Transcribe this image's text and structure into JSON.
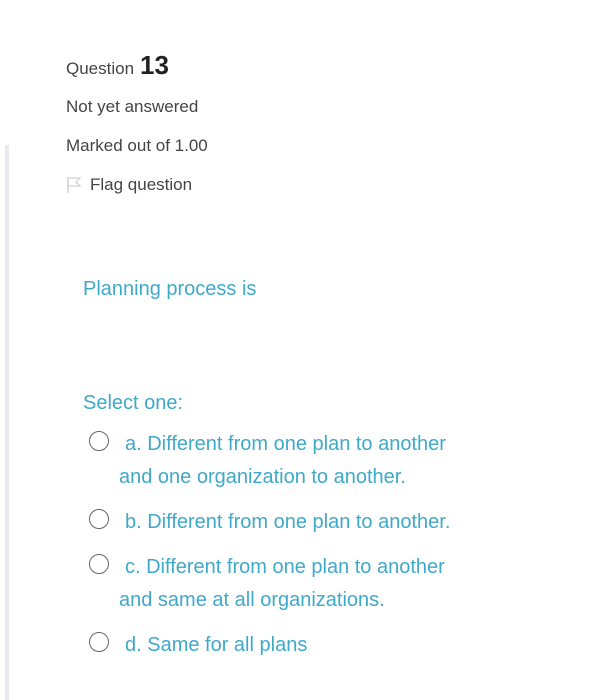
{
  "question": {
    "label": "Question",
    "number": "13",
    "state": "Not yet answered",
    "grade": "Marked out of 1.00",
    "flag_label": "Flag question",
    "flag_icon": "flag-icon"
  },
  "content": {
    "question_text": "Planning process is",
    "prompt": "Select one:",
    "options": [
      {
        "line1": "a. Different from one plan to another",
        "line2": "and one organization to another."
      },
      {
        "line1": "b. Different from one plan to another.",
        "line2": ""
      },
      {
        "line1": "c. Different from one plan to another",
        "line2": "and same at all organizations."
      },
      {
        "line1": "d. Same for all plans",
        "line2": ""
      }
    ]
  },
  "colors": {
    "accent": "#3fa9c9",
    "text": "#444444",
    "rule": "#e9ecef"
  }
}
